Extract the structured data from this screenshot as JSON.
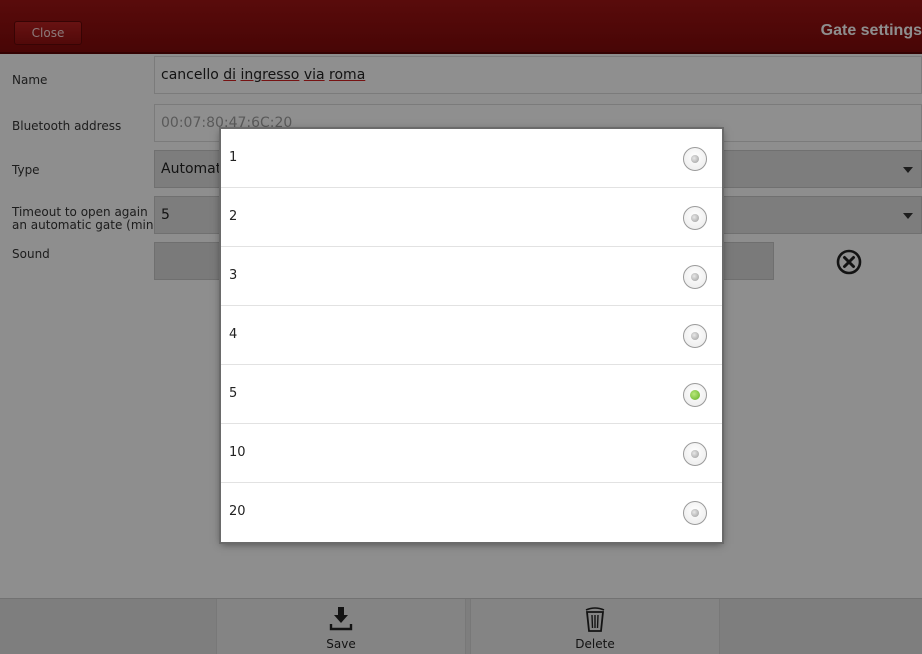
{
  "header": {
    "close_label": "Close",
    "title": "Gate settings"
  },
  "form": {
    "name": {
      "label": "Name",
      "value_words": [
        "cancello",
        "di",
        "ingresso",
        "via",
        "roma"
      ]
    },
    "bluetooth": {
      "label": "Bluetooth address",
      "value": "00:07:80:47:6C:20"
    },
    "type": {
      "label": "Type",
      "value": "Automati"
    },
    "timeout": {
      "label_line1": "Timeout to open again",
      "label_line2": "an automatic gate (min)",
      "value": "5"
    },
    "sound": {
      "label": "Sound"
    }
  },
  "footer": {
    "save_label": "Save",
    "delete_label": "Delete"
  },
  "dialog": {
    "options": [
      "1",
      "2",
      "3",
      "4",
      "5",
      "10",
      "20"
    ],
    "selected": "5",
    "accent_color": "#6abf2a"
  },
  "colors": {
    "header_red": "#8c0f0f"
  },
  "icons": [
    "close-circle-icon",
    "save-icon",
    "delete-icon",
    "radio-icon"
  ]
}
